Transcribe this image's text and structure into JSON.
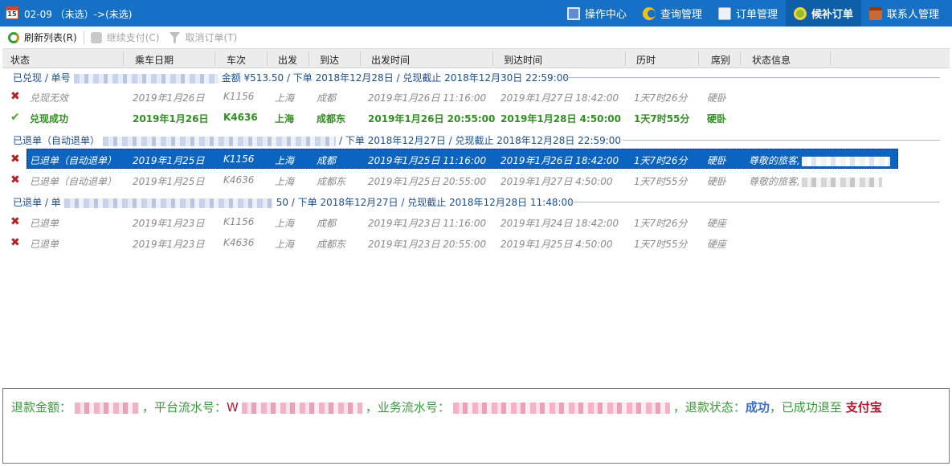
{
  "titlebar": {
    "title": "02-09 （未选）->(未选)",
    "calendar_day": "15",
    "nav": [
      {
        "label": "操作中心",
        "icon": "monitor-icon",
        "active": false
      },
      {
        "label": "查询管理",
        "icon": "query-icon",
        "active": false
      },
      {
        "label": "订单管理",
        "icon": "order-icon",
        "active": false
      },
      {
        "label": "候补订单",
        "icon": "standby-icon",
        "active": true
      },
      {
        "label": "联系人管理",
        "icon": "contact-icon",
        "active": false
      }
    ]
  },
  "toolbar": {
    "refresh_label": "刷新列表(R)",
    "continue_pay_label": "继续支付(C)",
    "cancel_order_label": "取消订单(T)"
  },
  "columns": [
    "状态",
    "乘车日期",
    "车次",
    "出发",
    "到达",
    "出发时间",
    "到达时间",
    "历时",
    "席别",
    "状态信息"
  ],
  "groups": [
    {
      "prefix": "已兑现 / 单号",
      "suffix": "金额 ¥513.50 / 下单 2018年12月28日 / 兑现截止 2018年12月30日 22:59:00",
      "rows": [
        {
          "status": "兑现无效",
          "date": "2019年1月26日",
          "train": "K1156",
          "from": "上海",
          "to": "成都",
          "depart": "2019年1月26日 11:16:00",
          "arrive": "2019年1月27日 18:42:00",
          "duration": "1天7时26分",
          "seat": "硬卧",
          "info": ""
        },
        {
          "status": "兑现成功",
          "date": "2019年1月26日",
          "train": "K4636",
          "from": "上海",
          "to": "成都东",
          "depart": "2019年1月26日 20:55:00",
          "arrive": "2019年1月28日 4:50:00",
          "duration": "1天7时55分",
          "seat": "硬卧",
          "info": ""
        }
      ]
    },
    {
      "prefix": "已退单（自动退单）",
      "suffix": "/ 下单 2018年12月27日 / 兑现截止 2018年12月28日 22:59:00",
      "rows": [
        {
          "status": "已退单（自动退单）",
          "date": "2019年1月25日",
          "train": "K1156",
          "from": "上海",
          "to": "成都",
          "depart": "2019年1月25日 11:16:00",
          "arrive": "2019年1月26日 18:42:00",
          "duration": "1天7时26分",
          "seat": "硬卧",
          "info": "尊敬的旅客,"
        },
        {
          "status": "已退单（自动退单）",
          "date": "2019年1月25日",
          "train": "K4636",
          "from": "上海",
          "to": "成都东",
          "depart": "2019年1月25日 20:55:00",
          "arrive": "2019年1月27日 4:50:00",
          "duration": "1天7时55分",
          "seat": "硬卧",
          "info": "尊敬的旅客,"
        }
      ]
    },
    {
      "prefix": "已退单 / 单",
      "suffix": "50 / 下单 2018年12月27日 / 兑现截止 2018年12月28日 11:48:00",
      "rows": [
        {
          "status": "已退单",
          "date": "2019年1月23日",
          "train": "K1156",
          "from": "上海",
          "to": "成都",
          "depart": "2019年1月23日 11:16:00",
          "arrive": "2019年1月24日 18:42:00",
          "duration": "1天7时26分",
          "seat": "硬座",
          "info": ""
        },
        {
          "status": "已退单",
          "date": "2019年1月23日",
          "train": "K4636",
          "from": "上海",
          "to": "成都东",
          "depart": "2019年1月23日 20:55:00",
          "arrive": "2019年1月25日 4:50:00",
          "duration": "1天7时55分",
          "seat": "硬座",
          "info": ""
        }
      ]
    }
  ],
  "refund": {
    "amount_label": "退款金额：",
    "platform_label": "，平台流水号：",
    "platform_prefix": "W",
    "business_label": "，业务流水号：",
    "status_label": "，退款状态：",
    "status_value": "成功",
    "refund_to_label": "，已成功退至",
    "refund_to_value": "支付宝"
  },
  "colors": {
    "title_bar": "#1671c6",
    "selected_row": "#0a64c0",
    "success_green": "#2f8f1f",
    "fail_red": "#b52222"
  }
}
